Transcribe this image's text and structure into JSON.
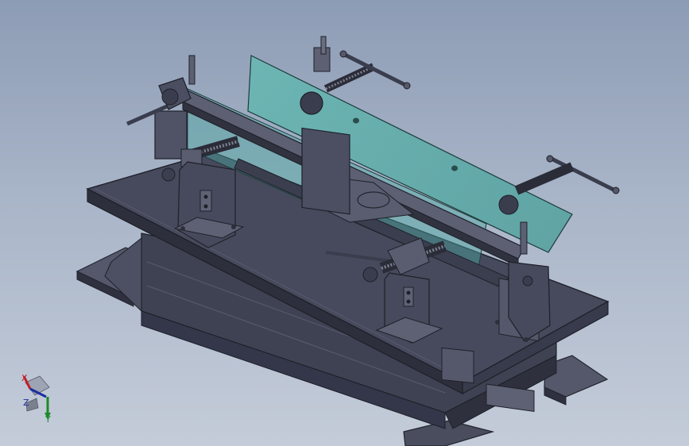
{
  "viewport": {
    "background_top": "#8d9cb5",
    "background_bottom": "#c4ccd9"
  },
  "model": {
    "body_color": "#3c3f4f",
    "highlight_color": "#6a6d80",
    "glass_color": "#4aa79f"
  },
  "triad": {
    "x_label": "X",
    "y_label": "Y",
    "z_label": "Z",
    "x_color": "#c0202a",
    "y_color": "#1c8a2a",
    "z_color": "#1b2f9e"
  }
}
